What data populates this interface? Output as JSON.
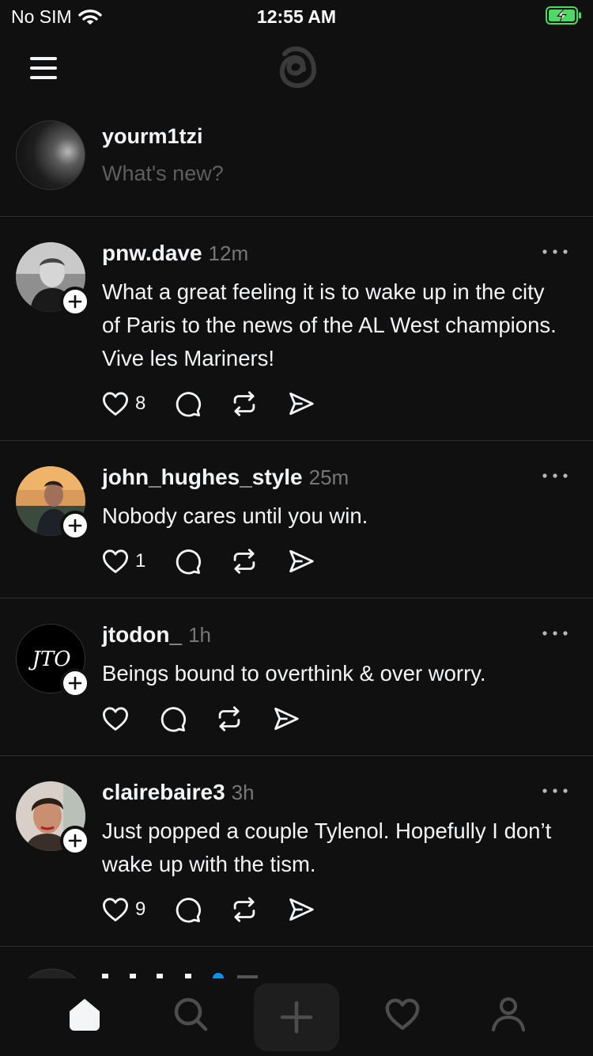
{
  "status_bar": {
    "carrier": "No SIM",
    "time": "12:55 AM",
    "battery_state": "charging"
  },
  "composer": {
    "username": "yourm1tzi",
    "placeholder": "What's new?"
  },
  "posts": [
    {
      "username": "pnw.dave",
      "time": "12m",
      "text": "What a great feeling it is to wake up in the city of Paris to the news of the AL West champions. Vive les Mariners!",
      "likes": "8"
    },
    {
      "username": "john_hughes_style",
      "time": "25m",
      "text": "Nobody cares until you win.",
      "likes": "1"
    },
    {
      "username": "jtodon_",
      "time": "1h",
      "text": "Beings bound to overthink & over worry.",
      "likes": ""
    },
    {
      "username": "clairebaire3",
      "time": "3h",
      "text": "Just popped a couple Tylenol. Hopefully I don’t wake up with the tism.",
      "likes": "9"
    }
  ],
  "avatar_badge_text": "JTO",
  "icons": [
    "menu-icon",
    "threads-logo-icon",
    "more-icon",
    "heart-icon",
    "comment-icon",
    "repost-icon",
    "share-icon",
    "follow-plus-icon",
    "home-icon",
    "search-icon",
    "plus-icon",
    "activity-heart-icon",
    "profile-icon"
  ],
  "colors": {
    "background": "#101010",
    "text": "#f3f5f7",
    "muted": "#777777",
    "divider": "#2e2e2e",
    "verified": "#0095f6",
    "battery": "#4cd964"
  }
}
